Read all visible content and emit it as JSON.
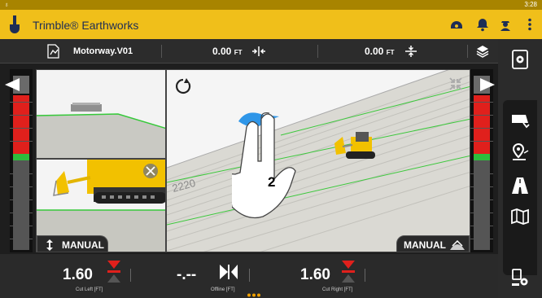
{
  "status_bar": {
    "time": "3:28"
  },
  "app_bar": {
    "title": "Trimble® Earthworks",
    "icons": [
      "connection-icon",
      "alert-bell-icon",
      "operator-icon",
      "overflow-menu-icon"
    ]
  },
  "info_bar": {
    "design_name": "Motorway.V01",
    "horizontal_offset": {
      "value": "0.00",
      "unit": "FT"
    },
    "vertical_offset": {
      "value": "0.00",
      "unit": "FT"
    }
  },
  "views": {
    "left_bottom_label": "MANUAL",
    "main_label": "MANUAL",
    "main_view_text": "2220",
    "gesture_fingers": "2"
  },
  "bottom_bar": {
    "cut_left": {
      "value": "1.60",
      "caption": "Cut Left [FT]"
    },
    "offline": {
      "value": "-.--",
      "caption": "Offline [FT]"
    },
    "cut_right": {
      "value": "1.60",
      "caption": "Cut Right [FT]"
    }
  },
  "colors": {
    "brand_yellow": "#f0bf1a",
    "cut_red": "#e0201c",
    "on_grade_green": "#2ebd3c",
    "machine_yellow": "#f2c100"
  }
}
